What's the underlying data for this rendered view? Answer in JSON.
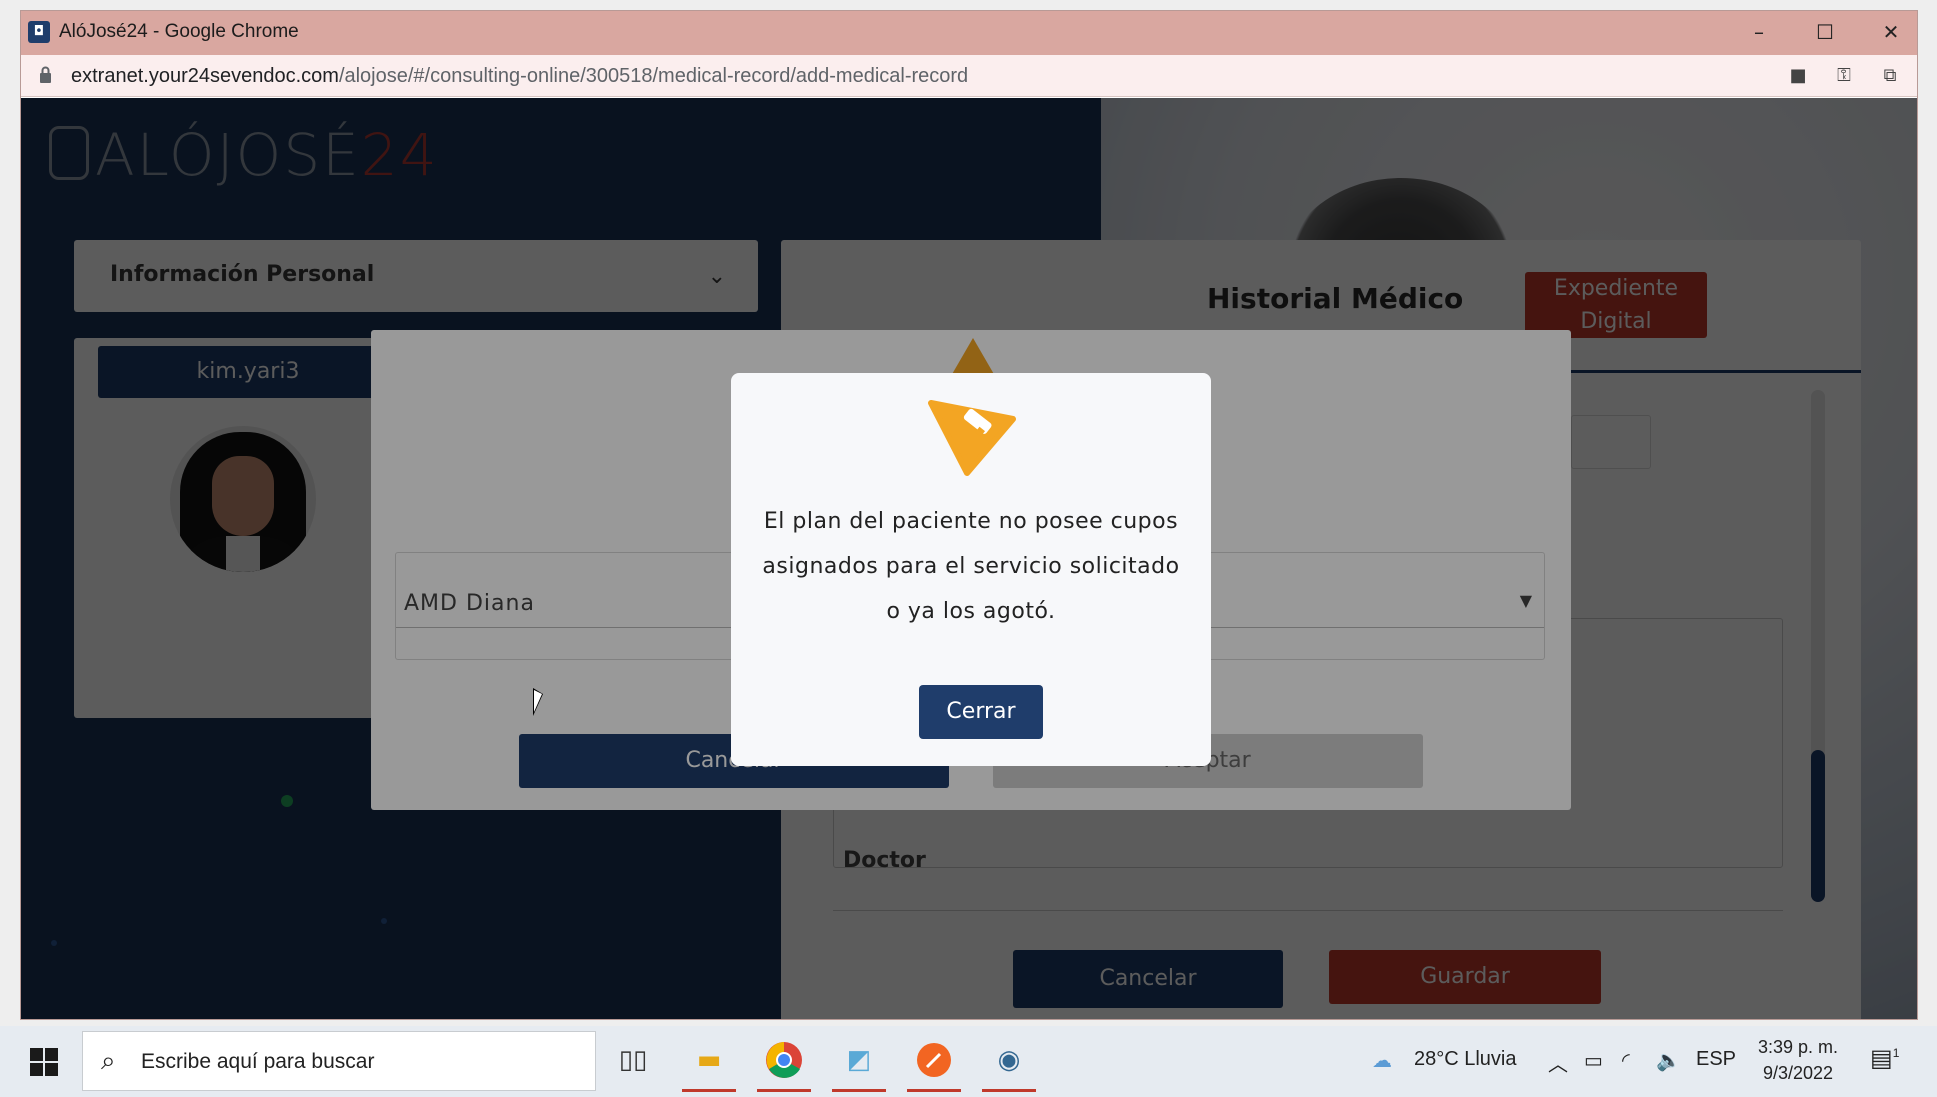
{
  "browser": {
    "title": "AlóJosé24 - Google Chrome",
    "url_domain": "extranet.your24sevendoc.com",
    "url_path": "/alojose/#/consulting-online/300518/medical-record/add-medical-record",
    "controls": {
      "minimize": "–",
      "maximize": "☐",
      "close": "✕"
    }
  },
  "logo": {
    "text": "ALÓJOSÉ",
    "number": "24"
  },
  "left_panel": {
    "header_label": "Información Personal",
    "username": "kim.yari3"
  },
  "history_panel": {
    "title": "Historial Médico",
    "expediente_line1": "Expediente",
    "expediente_line2": "Digital",
    "doctor_label": "Doctor",
    "cancel_label": "Cancelar",
    "save_label": "Guardar"
  },
  "background_modal": {
    "select_value": "AMD Diana",
    "cancel_label": "Cancelar",
    "accept_label": "Aceptar"
  },
  "alert": {
    "line1": "El plan del paciente no posee cupos",
    "line2": "asignados para el servicio solicitado",
    "line3": "o ya los agotó.",
    "close_label": "Cerrar"
  },
  "taskbar": {
    "search_placeholder": "Escribe aquí para buscar",
    "weather": "28°C  Lluvia",
    "language": "ESP",
    "time": "3:39 p. m.",
    "date": "9/3/2022",
    "notification_count": "1"
  },
  "colors": {
    "brand_navy": "#1f3d6b",
    "brand_red": "#c0392b",
    "warning_orange": "#f3a523"
  }
}
